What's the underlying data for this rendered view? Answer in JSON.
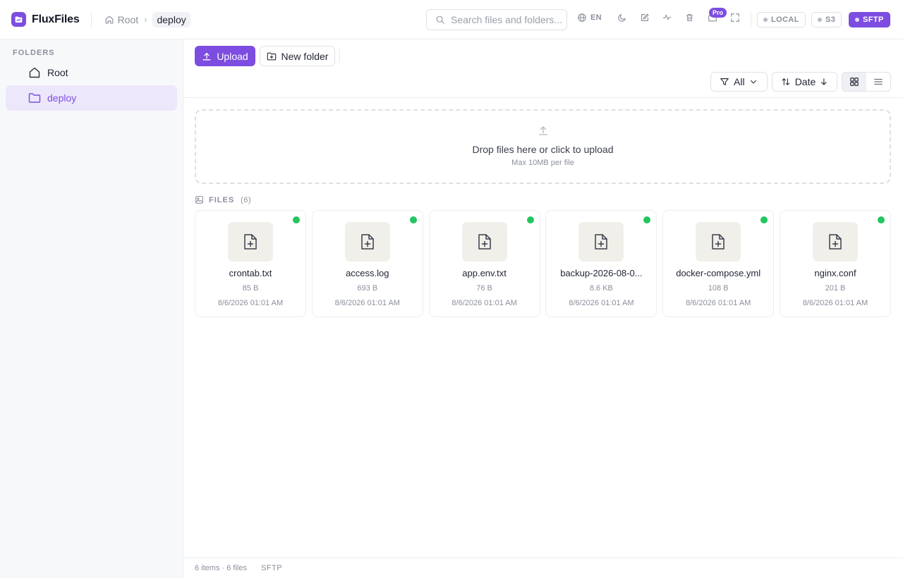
{
  "app": {
    "name": "FluxFiles"
  },
  "breadcrumb": {
    "root": "Root",
    "current": "deploy"
  },
  "search": {
    "placeholder": "Search files and folders..."
  },
  "toolbar": {
    "lang": "EN",
    "pro_badge": "Pro"
  },
  "storage": [
    {
      "label": "LOCAL",
      "active": false
    },
    {
      "label": "S3",
      "active": false
    },
    {
      "label": "SFTP",
      "active": true
    }
  ],
  "sidebar": {
    "title": "FOLDERS",
    "items": [
      {
        "label": "Root",
        "icon": "home-icon",
        "active": false
      },
      {
        "label": "deploy",
        "icon": "folder-icon",
        "active": true
      }
    ]
  },
  "actions": {
    "upload": "Upload",
    "new_folder": "New folder"
  },
  "filters": {
    "type": "All",
    "sort": "Date"
  },
  "dropzone": {
    "title": "Drop files here or click to upload",
    "subtitle": "Max 10MB per file"
  },
  "files_section": {
    "title": "FILES",
    "count": "(6)"
  },
  "files": [
    {
      "name": "crontab.txt",
      "size": "85 B",
      "date": "8/6/2026 01:01 AM"
    },
    {
      "name": "access.log",
      "size": "693 B",
      "date": "8/6/2026 01:01 AM"
    },
    {
      "name": "app.env.txt",
      "size": "76 B",
      "date": "8/6/2026 01:01 AM"
    },
    {
      "name": "backup-2026-08-0...",
      "size": "8.6 KB",
      "date": "8/6/2026 01:01 AM"
    },
    {
      "name": "docker-compose.yml",
      "size": "108 B",
      "date": "8/6/2026 01:01 AM"
    },
    {
      "name": "nginx.conf",
      "size": "201 B",
      "date": "8/6/2026 01:01 AM"
    }
  ],
  "footer": {
    "summary": "6 items · 6 files",
    "mode": "SFTP"
  },
  "colors": {
    "accent": "#7c4de0",
    "status_ok": "#22c55e"
  }
}
